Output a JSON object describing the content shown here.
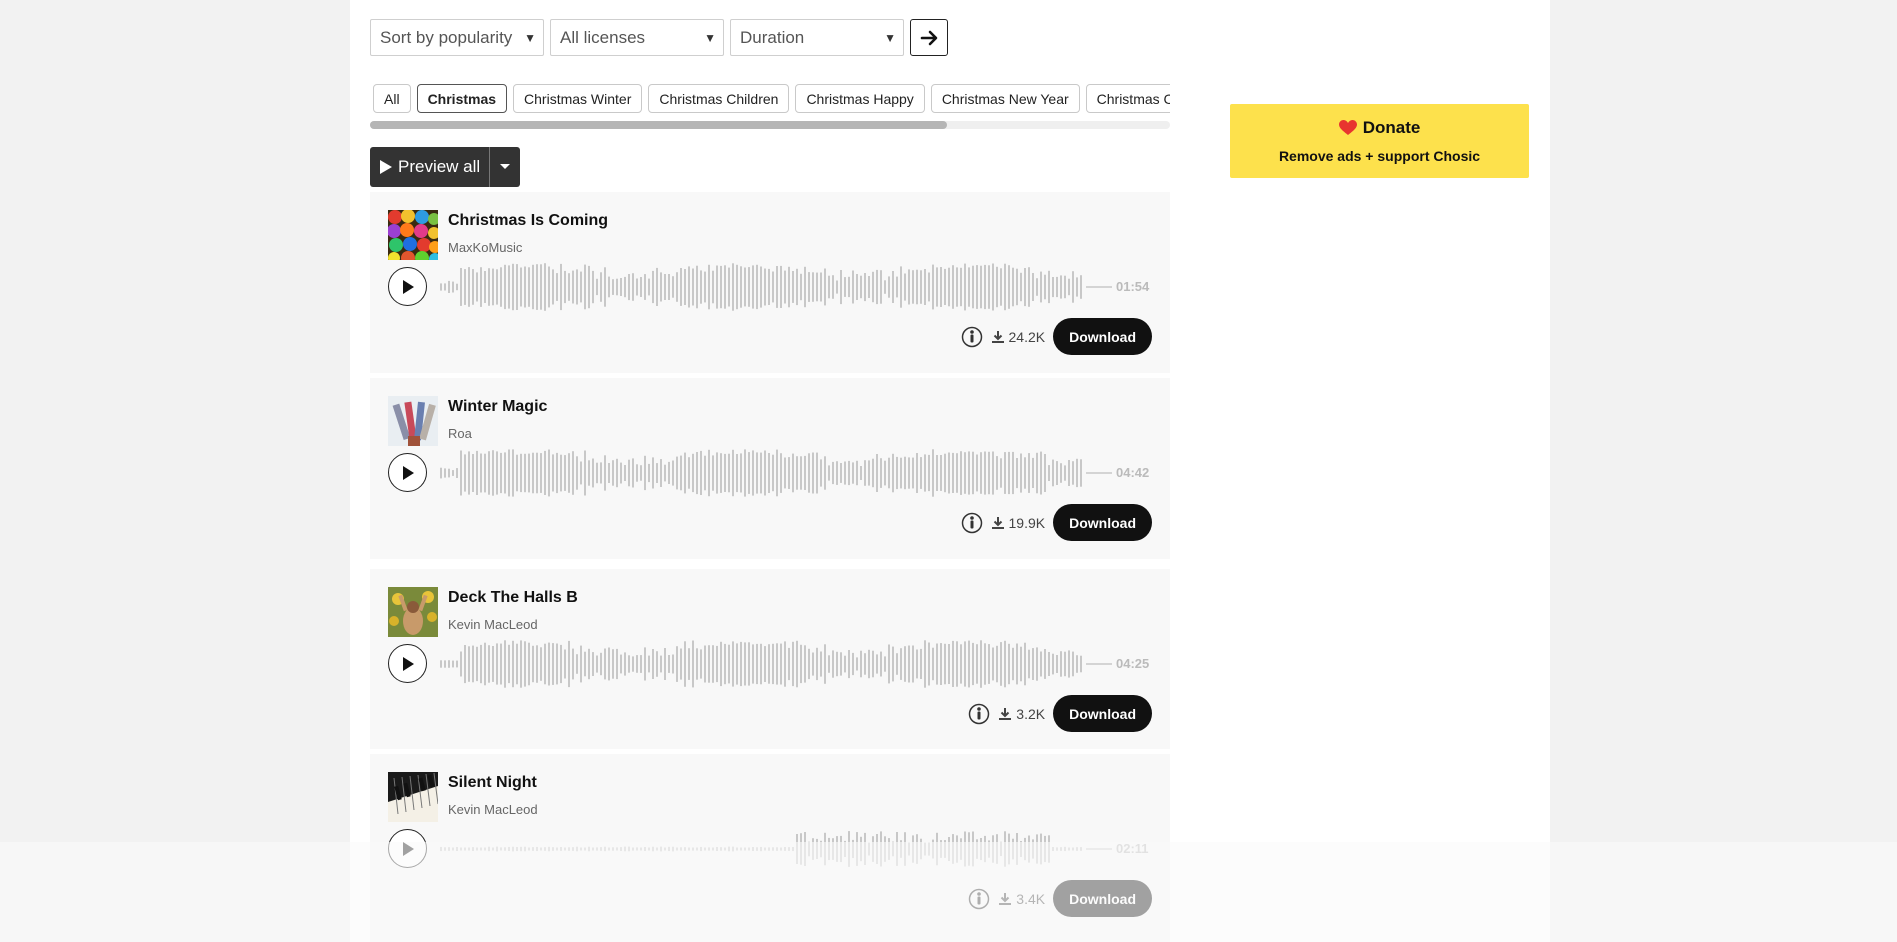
{
  "filters": {
    "sort": "Sort by popularity",
    "license": "All licenses",
    "duration": "Duration"
  },
  "chips": [
    "All",
    "Christmas",
    "Christmas Winter",
    "Christmas Children",
    "Christmas Happy",
    "Christmas New Year",
    "Christmas Celebration"
  ],
  "active_chip": "Christmas",
  "preview_all": "Preview all",
  "download_label": "Download",
  "tracks": [
    {
      "title": "Christmas Is Coming",
      "artist": "MaxKoMusic",
      "duration": "01:54",
      "downloads": "24.2K"
    },
    {
      "title": "Winter Magic",
      "artist": "Roa",
      "duration": "04:42",
      "downloads": "19.9K"
    },
    {
      "title": "Deck The Halls B",
      "artist": "Kevin MacLeod",
      "duration": "04:25",
      "downloads": "3.2K"
    },
    {
      "title": "Silent Night",
      "artist": "Kevin MacLeod",
      "duration": "02:11",
      "downloads": "3.4K"
    }
  ],
  "donate": {
    "title": "Donate",
    "subtitle": "Remove ads + support Chosic"
  },
  "colors": {
    "accent_yellow": "#fde14c",
    "heart_red": "#e8352f",
    "button_dark": "#111111",
    "waveform_gray": "#c8c8c8"
  }
}
